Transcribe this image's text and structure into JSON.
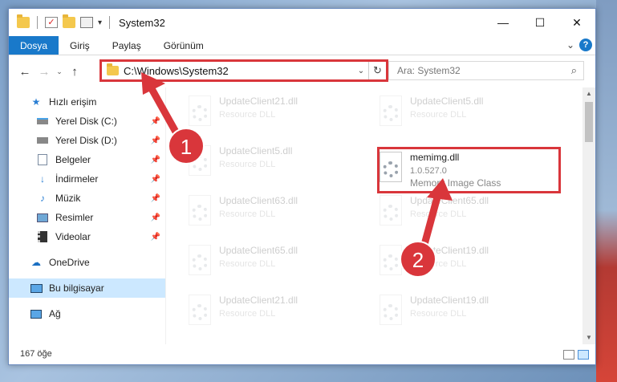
{
  "window": {
    "title": "System32",
    "controls": {
      "minimize": "—",
      "maximize": "☐",
      "close": "✕"
    }
  },
  "quick_access_toolbar": {
    "dropdown": "▾"
  },
  "ribbon": {
    "tabs": [
      "Dosya",
      "Giriş",
      "Paylaş",
      "Görünüm"
    ],
    "expand": "⌄",
    "help": "?"
  },
  "navigation": {
    "back": "←",
    "forward": "→",
    "recent": "⌄",
    "up": "↑",
    "address": "C:\\Windows\\System32",
    "address_dropdown": "⌄",
    "refresh": "↻",
    "search_placeholder": "Ara: System32",
    "search_icon": "⌕"
  },
  "sidebar": {
    "quick_access": "Hızlı erişim",
    "pinned": [
      {
        "label": "Yerel Disk (C:)",
        "icon": "drive-icon"
      },
      {
        "label": "Yerel Disk (D:)",
        "icon": "drive-icon"
      },
      {
        "label": "Belgeler",
        "icon": "documents-icon"
      },
      {
        "label": "İndirmeler",
        "icon": "download-icon"
      },
      {
        "label": "Müzik",
        "icon": "music-icon"
      },
      {
        "label": "Resimler",
        "icon": "pictures-icon"
      },
      {
        "label": "Videolar",
        "icon": "video-icon"
      }
    ],
    "onedrive": "OneDrive",
    "this_pc": "Bu bilgisayar",
    "network": "Ağ"
  },
  "files": {
    "left_column": [
      {
        "name": "UpdateClient21.dll",
        "type": "Resource DLL"
      },
      {
        "name": "UpdateClient5.dll",
        "type": "Resource DLL"
      },
      {
        "name": "UpdateClient63.dll",
        "type": "Resource DLL"
      },
      {
        "name": "UpdateClient65.dll",
        "type": "Resource DLL"
      },
      {
        "name": "UpdateClient21.dll",
        "type": "Resource DLL"
      }
    ],
    "right_column": [
      {
        "name": "UpdateClient5.dll",
        "type": "Resource DLL"
      },
      {
        "name": "UpdateClient65.dll",
        "type": "Resource DLL"
      },
      {
        "name": "UpdateClient19.dll",
        "type": "Resource DLL"
      },
      {
        "name": "UpdateClient19.dll",
        "type": "Resource DLL"
      }
    ],
    "selected": {
      "name": "memimg.dll",
      "version": "1.0.527.0",
      "description": "Memory Image Class"
    }
  },
  "status": {
    "item_count": "167 öğe"
  },
  "annotations": {
    "badge1": "1",
    "badge2": "2",
    "color": "#d9363b"
  }
}
